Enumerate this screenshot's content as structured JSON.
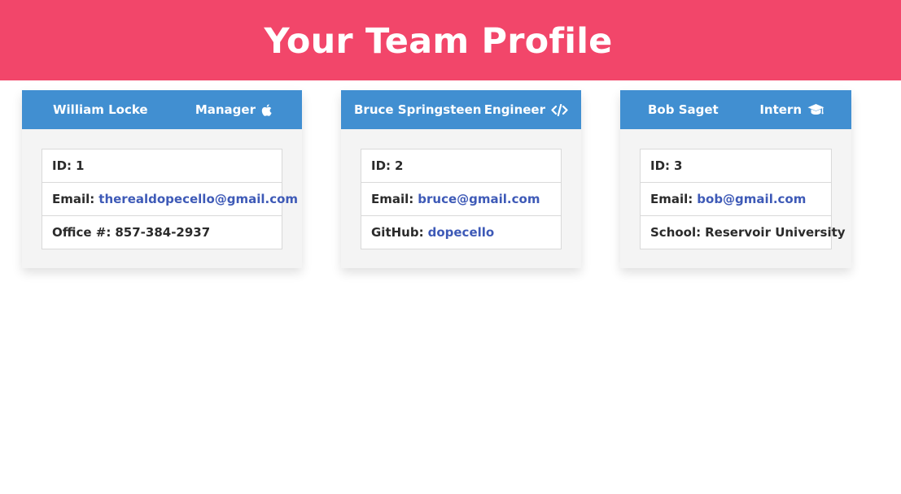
{
  "header": {
    "title": "Your Team Profile"
  },
  "team": [
    {
      "name": "William Locke",
      "role": "Manager",
      "role_icon": "apple-icon",
      "rows": [
        {
          "label": "ID:",
          "value": "1"
        },
        {
          "label": "Email:",
          "value": "therealdopecello@gmail.com"
        },
        {
          "label": "Office #:",
          "value": "857-384-2937"
        }
      ]
    },
    {
      "name": "Bruce Springsteen",
      "role": "Engineer",
      "role_icon": "code-icon",
      "rows": [
        {
          "label": "ID:",
          "value": "2"
        },
        {
          "label": "Email:",
          "value": "bruce@gmail.com"
        },
        {
          "label": "GitHub:",
          "value": "dopecello"
        }
      ]
    },
    {
      "name": "Bob Saget",
      "role": "Intern",
      "role_icon": "graduation-cap-icon",
      "rows": [
        {
          "label": "ID:",
          "value": "3"
        },
        {
          "label": "Email:",
          "value": "bob@gmail.com"
        },
        {
          "label": "School:",
          "value": "Reservoir University"
        }
      ]
    }
  ],
  "colors": {
    "banner": "#f2466a",
    "card_header": "#418fd1",
    "link": "#3e5ab7",
    "card_body": "#f4f4f4"
  }
}
